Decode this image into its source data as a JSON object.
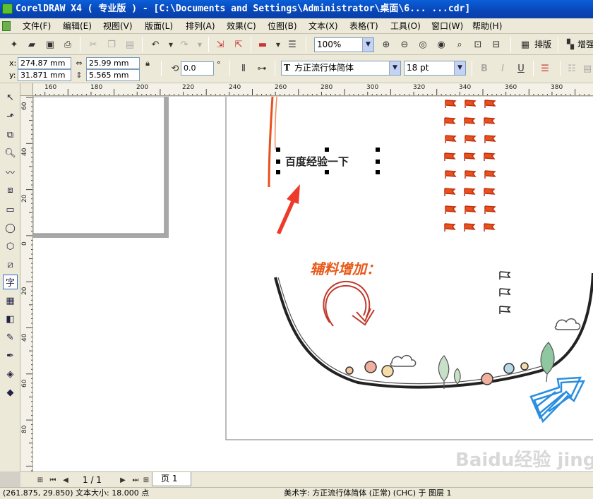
{
  "window": {
    "title": "CorelDRAW X4 ( 专业版 ) - [C:\\Documents and Settings\\Administrator\\桌面\\6... ...cdr]"
  },
  "menu": [
    {
      "id": "file",
      "label": "文件(F)"
    },
    {
      "id": "edit",
      "label": "编辑(E)"
    },
    {
      "id": "view",
      "label": "视图(V)"
    },
    {
      "id": "layout",
      "label": "版面(L)"
    },
    {
      "id": "arrange",
      "label": "排列(A)"
    },
    {
      "id": "effects",
      "label": "效果(C)"
    },
    {
      "id": "bitmaps",
      "label": "位图(B)"
    },
    {
      "id": "text",
      "label": "文本(X)"
    },
    {
      "id": "table",
      "label": "表格(T)"
    },
    {
      "id": "tools",
      "label": "工具(O)"
    },
    {
      "id": "window",
      "label": "窗口(W)"
    },
    {
      "id": "help",
      "label": "帮助(H)"
    }
  ],
  "toolbar": {
    "zoom_value": "100%",
    "layout_label": "排版",
    "enhance_label": "增强"
  },
  "property_bar": {
    "x_label": "x:",
    "x_value": "274.87 mm",
    "y_label": "y:",
    "y_value": "31.871 mm",
    "width_value": "25.99 mm",
    "height_value": "5.565 mm",
    "rotation_value": "0.0",
    "degree_symbol": "°",
    "font_name": "方正流行体简体",
    "font_size": "18 pt"
  },
  "ruler_h_labels": [
    "160",
    "180",
    "200",
    "220",
    "240",
    "260",
    "280",
    "300",
    "320",
    "340",
    "360",
    "380"
  ],
  "ruler_v_labels": [
    "60",
    "40",
    "20",
    "0",
    "20",
    "40",
    "60",
    "80"
  ],
  "canvas": {
    "selected_text": "百度经验一下",
    "heading_text": "辅料增加："
  },
  "pagebar": {
    "page_counter": "1 / 1",
    "page_tab": "页 1"
  },
  "status": {
    "left": "(261.875, 29.850) 文本大小: 18.000 点",
    "right": "美术字: 方正流行体简体 (正常) (CHC) 于 图层 1"
  },
  "watermark": "Baidu经验 jingyan.baidu.com"
}
